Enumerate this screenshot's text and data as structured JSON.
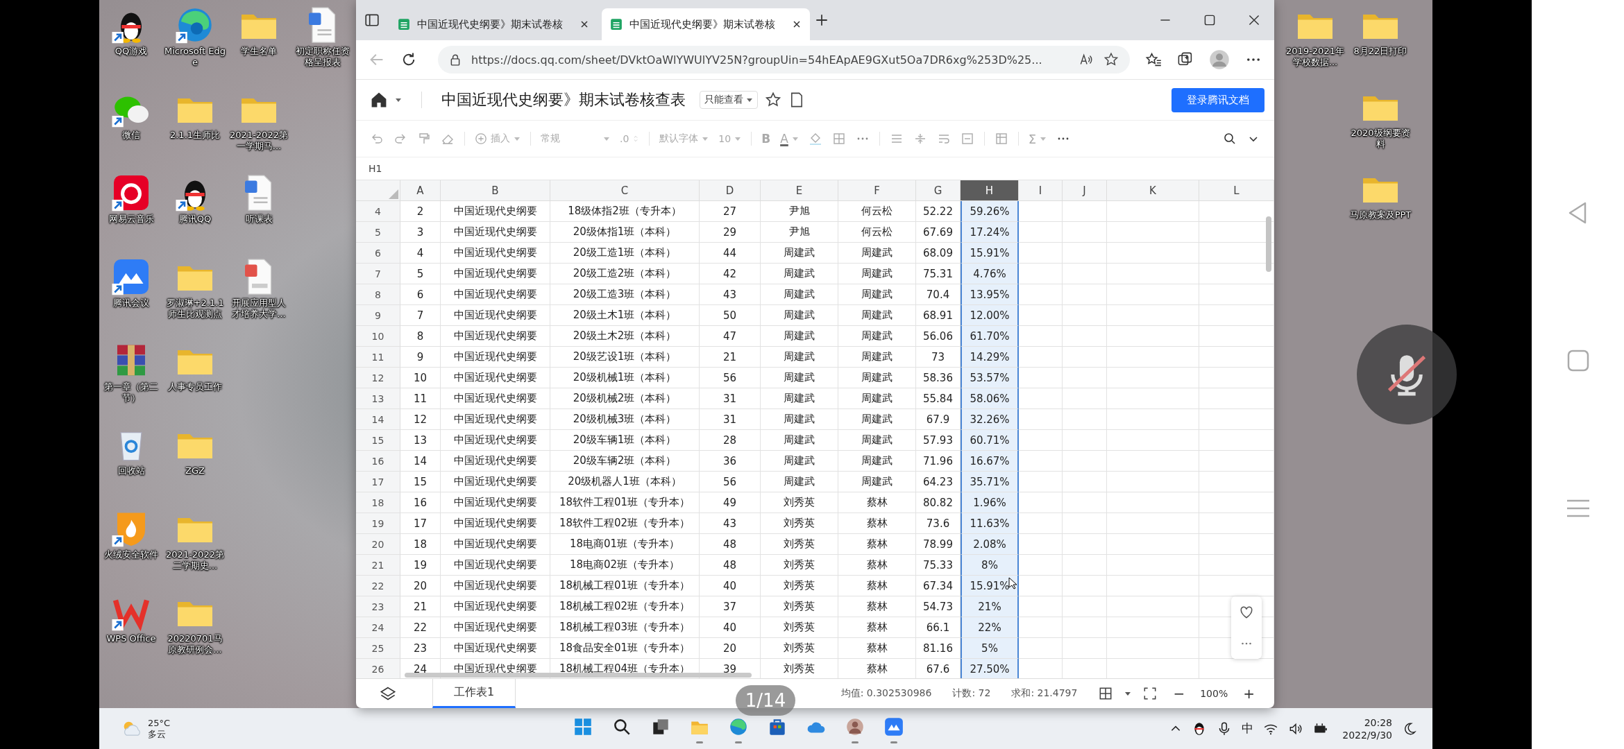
{
  "desktop": {
    "left_columns": [
      {
        "icons": [
          {
            "label": "QQ游戏",
            "kind": "penguin",
            "shortcut": true
          },
          {
            "label": "微信",
            "kind": "chat",
            "shortcut": true
          },
          {
            "label": "网易云音乐",
            "kind": "music",
            "shortcut": true
          },
          {
            "label": "腾讯会议",
            "kind": "meeting",
            "shortcut": true
          },
          {
            "label": "第一章（第二节）",
            "kind": "archive",
            "shortcut": false
          },
          {
            "label": "回收站",
            "kind": "recycle",
            "shortcut": false
          },
          {
            "label": "火绒安全软件",
            "kind": "shield",
            "shortcut": true
          },
          {
            "label": "WPS Office",
            "kind": "wps",
            "shortcut": true
          }
        ]
      },
      {
        "icons": [
          {
            "label": "Microsoft Edge",
            "kind": "edge",
            "shortcut": true
          },
          {
            "label": "2.1.1生师比",
            "kind": "folder",
            "shortcut": false
          },
          {
            "label": "腾讯QQ",
            "kind": "penguin",
            "shortcut": true
          },
          {
            "label": "罗淑琳+2.1.1师生比观测点",
            "kind": "folder",
            "shortcut": false
          },
          {
            "label": "人事专员工作",
            "kind": "folder",
            "shortcut": false
          },
          {
            "label": "ZGZ",
            "kind": "folder",
            "shortcut": false
          },
          {
            "label": "2021-2022第二学期史...",
            "kind": "folder",
            "shortcut": false
          },
          {
            "label": "20220701马原教研例会...",
            "kind": "folder",
            "shortcut": false
          }
        ]
      },
      {
        "icons": [
          {
            "label": "学生名单",
            "kind": "folder",
            "shortcut": false
          },
          {
            "label": "2021-2022第一学期马...",
            "kind": "folder",
            "shortcut": false
          },
          {
            "label": "听课表",
            "kind": "word",
            "shortcut": false
          },
          {
            "label": "开展应用型人才培养大学...",
            "kind": "pdf",
            "shortcut": false
          }
        ]
      },
      {
        "icons": [
          {
            "label": "初定职称任资格呈报表",
            "kind": "word",
            "shortcut": false
          }
        ]
      }
    ],
    "right_columns": [
      {
        "icons": [
          {
            "label": "2019-2021年学校数据...",
            "kind": "folder",
            "shortcut": false
          }
        ]
      },
      {
        "icons": [
          {
            "label": "8月22日打印",
            "kind": "folder",
            "shortcut": false
          },
          {
            "label": "2020级纲要资料",
            "kind": "folder",
            "shortcut": false
          },
          {
            "label": "马原教案及PPT",
            "kind": "folder",
            "shortcut": false
          }
        ]
      }
    ]
  },
  "browser": {
    "tabs": [
      {
        "title": "中国近现代史纲要》期末试卷核",
        "selected": false
      },
      {
        "title": "中国近现代史纲要》期末试卷核",
        "selected": true
      }
    ],
    "url": "https://docs.qq.com/sheet/DVktOaWlYWUlYV25N?groupUin=54hEApAE9GXut5Oa7DR6xg%253D%25..."
  },
  "doc": {
    "title": "中国近现代史纲要》期末试卷核查表",
    "mode": "只能查看",
    "login_button": "登录腾讯文档"
  },
  "toolbar": {
    "insert": "插入",
    "number_format": "常规",
    "decimal": ".0",
    "font": "默认字体",
    "font_size": "10",
    "bold": "B",
    "font_color": "A",
    "sum": "Σ"
  },
  "cell_ref": "H1",
  "sheet": {
    "columns": [
      {
        "label": "A",
        "selected": false
      },
      {
        "label": "B",
        "selected": false
      },
      {
        "label": "C",
        "selected": false
      },
      {
        "label": "D",
        "selected": false
      },
      {
        "label": "E",
        "selected": false
      },
      {
        "label": "F",
        "selected": false
      },
      {
        "label": "G",
        "selected": false
      },
      {
        "label": "H",
        "selected": true
      },
      {
        "label": "I",
        "selected": false
      },
      {
        "label": "J",
        "selected": false
      },
      {
        "label": "K",
        "selected": false
      },
      {
        "label": "L",
        "selected": false
      }
    ],
    "rows": [
      {
        "number": "4",
        "cells": [
          "2",
          "中国近现代史纲要",
          "18级体指2班（专升本）",
          "27",
          "尹旭",
          "何云松",
          "52.22",
          "59.26%"
        ]
      },
      {
        "number": "5",
        "cells": [
          "3",
          "中国近现代史纲要",
          "20级体指1班（本科）",
          "29",
          "尹旭",
          "何云松",
          "67.69",
          "17.24%"
        ]
      },
      {
        "number": "6",
        "cells": [
          "4",
          "中国近现代史纲要",
          "20级工造1班（本科）",
          "44",
          "周建武",
          "周建武",
          "68.09",
          "15.91%"
        ]
      },
      {
        "number": "7",
        "cells": [
          "5",
          "中国近现代史纲要",
          "20级工造2班（本科）",
          "42",
          "周建武",
          "周建武",
          "75.31",
          "4.76%"
        ]
      },
      {
        "number": "8",
        "cells": [
          "6",
          "中国近现代史纲要",
          "20级工造3班（本科）",
          "43",
          "周建武",
          "周建武",
          "70.4",
          "13.95%"
        ]
      },
      {
        "number": "9",
        "cells": [
          "7",
          "中国近现代史纲要",
          "20级土木1班（本科）",
          "50",
          "周建武",
          "周建武",
          "68.91",
          "12.00%"
        ]
      },
      {
        "number": "10",
        "cells": [
          "8",
          "中国近现代史纲要",
          "20级土木2班（本科）",
          "47",
          "周建武",
          "周建武",
          "56.06",
          "61.70%"
        ]
      },
      {
        "number": "11",
        "cells": [
          "9",
          "中国近现代史纲要",
          "20级艺设1班（本科）",
          "21",
          "周建武",
          "周建武",
          "73",
          "14.29%"
        ]
      },
      {
        "number": "12",
        "cells": [
          "10",
          "中国近现代史纲要",
          "20级机械1班（本科）",
          "56",
          "周建武",
          "周建武",
          "58.36",
          "53.57%"
        ]
      },
      {
        "number": "13",
        "cells": [
          "11",
          "中国近现代史纲要",
          "20级机械2班（本科）",
          "31",
          "周建武",
          "周建武",
          "55.84",
          "58.06%"
        ]
      },
      {
        "number": "14",
        "cells": [
          "12",
          "中国近现代史纲要",
          "20级机械3班（本科）",
          "31",
          "周建武",
          "周建武",
          "67.9",
          "32.26%"
        ]
      },
      {
        "number": "15",
        "cells": [
          "13",
          "中国近现代史纲要",
          "20级车辆1班（本科）",
          "28",
          "周建武",
          "周建武",
          "57.93",
          "60.71%"
        ]
      },
      {
        "number": "16",
        "cells": [
          "14",
          "中国近现代史纲要",
          "20级车辆2班（本科）",
          "36",
          "周建武",
          "周建武",
          "71.96",
          "16.67%"
        ]
      },
      {
        "number": "17",
        "cells": [
          "15",
          "中国近现代史纲要",
          "20级机器人1班（本科）",
          "56",
          "周建武",
          "周建武",
          "64.23",
          "35.71%"
        ]
      },
      {
        "number": "18",
        "cells": [
          "16",
          "中国近现代史纲要",
          "18软件工程01班（专升本）",
          "49",
          "刘秀英",
          "蔡林",
          "80.82",
          "1.96%"
        ]
      },
      {
        "number": "19",
        "cells": [
          "17",
          "中国近现代史纲要",
          "18软件工程02班（专升本）",
          "43",
          "刘秀英",
          "蔡林",
          "73.6",
          "11.63%"
        ]
      },
      {
        "number": "20",
        "cells": [
          "18",
          "中国近现代史纲要",
          "18电商01班（专升本）",
          "48",
          "刘秀英",
          "蔡林",
          "78.99",
          "2.08%"
        ]
      },
      {
        "number": "21",
        "cells": [
          "19",
          "中国近现代史纲要",
          "18电商02班（专升本）",
          "48",
          "刘秀英",
          "蔡林",
          "75.33",
          "8%"
        ]
      },
      {
        "number": "22",
        "cells": [
          "20",
          "中国近现代史纲要",
          "18机械工程01班（专升本）",
          "40",
          "刘秀英",
          "蔡林",
          "67.34",
          "15.91%"
        ]
      },
      {
        "number": "23",
        "cells": [
          "21",
          "中国近现代史纲要",
          "18机械工程02班（专升本）",
          "37",
          "刘秀英",
          "蔡林",
          "54.73",
          "21%"
        ]
      },
      {
        "number": "24",
        "cells": [
          "22",
          "中国近现代史纲要",
          "18机械工程03班（专升本）",
          "40",
          "刘秀英",
          "蔡林",
          "66.1",
          "22%"
        ]
      },
      {
        "number": "25",
        "cells": [
          "23",
          "中国近现代史纲要",
          "18食品安全01班（专升本）",
          "20",
          "刘秀英",
          "蔡林",
          "81.16",
          "5%"
        ]
      },
      {
        "number": "26",
        "cells": [
          "24",
          "中国近现代史纲要",
          "18机械工程04班（专升本）",
          "39",
          "刘秀英",
          "蔡林",
          "67.6",
          "27.50%"
        ]
      }
    ]
  },
  "sheet_tabs": [
    {
      "label": "工作表1",
      "selected": true
    }
  ],
  "status": {
    "average": "均值: 0.302530986",
    "count": "计数: 72",
    "sum": "求和: 21.4797",
    "zoom_out": "−",
    "zoom": "100%",
    "zoom_in": "+"
  },
  "page_indicator": "1/14",
  "taskbar": {
    "weather": {
      "temperature": "25°C",
      "condition": "多云"
    },
    "apps": [
      {
        "kind": "start",
        "running": false
      },
      {
        "kind": "search",
        "running": false
      },
      {
        "kind": "taskview",
        "running": false
      },
      {
        "kind": "explorer",
        "running": true
      },
      {
        "kind": "edge",
        "running": true
      },
      {
        "kind": "store",
        "running": false
      },
      {
        "kind": "cloud",
        "running": false
      },
      {
        "kind": "avatar",
        "running": true
      },
      {
        "kind": "meeting",
        "running": true
      }
    ],
    "ime": "中",
    "time": "20:28",
    "date": "2022/9/30"
  }
}
